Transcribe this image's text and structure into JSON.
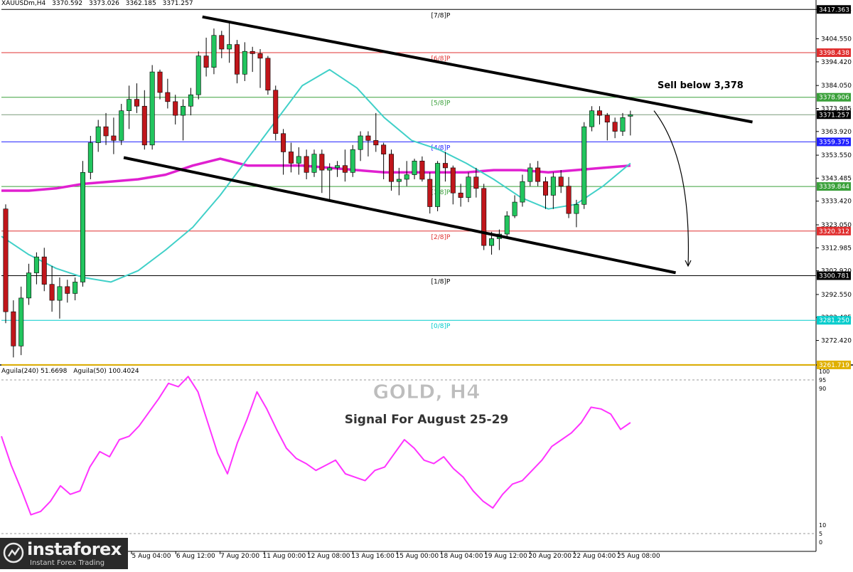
{
  "header": {
    "symbol": "XAUUSDm,H4",
    "ohlc": [
      "3370.592",
      "3373.026",
      "3362.185",
      "3371.257"
    ]
  },
  "indicator_header": {
    "name1": "Aguila(240) 51.6698",
    "name2": "Aguila(50) 100.4024"
  },
  "overlay": {
    "title": "GOLD, H4",
    "subtitle": "Signal For August 25-29",
    "annotation": "Sell below 3,378"
  },
  "logo": {
    "name": "instaforex",
    "tagline": "Instant Forex Trading"
  },
  "colors": {
    "bull": "#22c55e",
    "bear": "#c0161b",
    "ma_fast": "#40d0c8",
    "ma_slow": "#e020d0",
    "rsi": "#ff33ff",
    "murrey_red": "#e03030",
    "murrey_green": "#3aa03a",
    "murrey_blue": "#2020ff",
    "murrey_black": "#000000",
    "murrey_cyan": "#00cccc",
    "murrey_yellow": "#e0b000",
    "channel": "#000000"
  },
  "chart_data": {
    "type": "candlestick",
    "ylim": [
      3262,
      3419
    ],
    "y_ticks": [
      "3417.363",
      "3404.550",
      "3394.420",
      "3384.050",
      "3373.985",
      "3363.920",
      "3353.550",
      "3343.485",
      "3333.420",
      "3323.050",
      "3312.985",
      "3302.920",
      "3292.550",
      "3282.485",
      "3272.420"
    ],
    "x_labels": [
      "5 Aug 04:00",
      "6 Aug 12:00",
      "7 Aug 20:00",
      "11 Aug 00:00",
      "12 Aug 08:00",
      "13 Aug 16:00",
      "15 Aug 00:00",
      "18 Aug 04:00",
      "19 Aug 12:00",
      "20 Aug 20:00",
      "22 Aug 04:00",
      "25 Aug 08:00"
    ],
    "murrey_levels": [
      {
        "label": "[7/8]P",
        "price": "3417.363",
        "color": "murrey_black"
      },
      {
        "label": "[6/8]P",
        "price": "3398.438",
        "color": "murrey_red"
      },
      {
        "label": "[5/8]P",
        "price": "3378.906",
        "color": "murrey_green"
      },
      {
        "label": "[4/8]P",
        "price": "3359.375",
        "color": "murrey_blue"
      },
      {
        "label": "[3/8]P",
        "price": "3339.844",
        "color": "murrey_green"
      },
      {
        "label": "[2/8]P",
        "price": "3320.312",
        "color": "murrey_red"
      },
      {
        "label": "[1/8]P",
        "price": "3300.781",
        "color": "murrey_black"
      },
      {
        "label": "[0/8]P",
        "price": "3281.250",
        "color": "murrey_cyan"
      },
      {
        "label": "",
        "price": "3261.719",
        "color": "murrey_yellow"
      }
    ],
    "current_price": "3371.257",
    "candles": [
      [
        3330,
        3332,
        3280,
        3285
      ],
      [
        3285,
        3290,
        3265,
        3270
      ],
      [
        3270,
        3296,
        3266,
        3291
      ],
      [
        3291,
        3306,
        3288,
        3302
      ],
      [
        3302,
        3311,
        3297,
        3309
      ],
      [
        3309,
        3313,
        3294,
        3297
      ],
      [
        3297,
        3305,
        3285,
        3290
      ],
      [
        3290,
        3300,
        3282,
        3296
      ],
      [
        3296,
        3299,
        3289,
        3293
      ],
      [
        3293,
        3300,
        3290,
        3298
      ],
      [
        3298,
        3351,
        3296,
        3346
      ],
      [
        3346,
        3362,
        3343,
        3359
      ],
      [
        3359,
        3369,
        3355,
        3366
      ],
      [
        3366,
        3372,
        3358,
        3362
      ],
      [
        3362,
        3370,
        3354,
        3360
      ],
      [
        3360,
        3376,
        3358,
        3373
      ],
      [
        3373,
        3384,
        3365,
        3378
      ],
      [
        3378,
        3385,
        3372,
        3375
      ],
      [
        3375,
        3382,
        3356,
        3358
      ],
      [
        3358,
        3393,
        3356,
        3390
      ],
      [
        3390,
        3391,
        3378,
        3381
      ],
      [
        3381,
        3387,
        3374,
        3377
      ],
      [
        3377,
        3380,
        3367,
        3371
      ],
      [
        3371,
        3378,
        3360,
        3375
      ],
      [
        3375,
        3383,
        3371,
        3380
      ],
      [
        3380,
        3399,
        3378,
        3397
      ],
      [
        3397,
        3405,
        3388,
        3392
      ],
      [
        3392,
        3409,
        3389,
        3406
      ],
      [
        3406,
        3408,
        3396,
        3400
      ],
      [
        3400,
        3412,
        3394,
        3402
      ],
      [
        3402,
        3404,
        3385,
        3389
      ],
      [
        3389,
        3403,
        3386,
        3399
      ],
      [
        3399,
        3401,
        3390,
        3398
      ],
      [
        3398,
        3400,
        3383,
        3396
      ],
      [
        3396,
        3397,
        3380,
        3382
      ],
      [
        3382,
        3384,
        3360,
        3363
      ],
      [
        3363,
        3365,
        3345,
        3355
      ],
      [
        3355,
        3359,
        3346,
        3350
      ],
      [
        3350,
        3357,
        3345,
        3353
      ],
      [
        3353,
        3356,
        3343,
        3346
      ],
      [
        3346,
        3356,
        3344,
        3354
      ],
      [
        3354,
        3356,
        3337,
        3347
      ],
      [
        3347,
        3350,
        3334,
        3348
      ],
      [
        3348,
        3351,
        3344,
        3349
      ],
      [
        3349,
        3356,
        3342,
        3346
      ],
      [
        3346,
        3358,
        3344,
        3356
      ],
      [
        3356,
        3364,
        3351,
        3362
      ],
      [
        3362,
        3364,
        3353,
        3360
      ],
      [
        3360,
        3372,
        3355,
        3358
      ],
      [
        3358,
        3359,
        3343,
        3354
      ],
      [
        3354,
        3356,
        3338,
        3342
      ],
      [
        3342,
        3348,
        3336,
        3343
      ],
      [
        3343,
        3351,
        3340,
        3345
      ],
      [
        3345,
        3352,
        3343,
        3351
      ],
      [
        3351,
        3353,
        3342,
        3343
      ],
      [
        3343,
        3346,
        3328,
        3331
      ],
      [
        3331,
        3351,
        3329,
        3350
      ],
      [
        3350,
        3355,
        3342,
        3348
      ],
      [
        3348,
        3349,
        3332,
        3337
      ],
      [
        3337,
        3341,
        3331,
        3335
      ],
      [
        3335,
        3346,
        3333,
        3344
      ],
      [
        3344,
        3348,
        3335,
        3339
      ],
      [
        3339,
        3341,
        3312,
        3314
      ],
      [
        3314,
        3320,
        3310,
        3317
      ],
      [
        3317,
        3321,
        3312,
        3319
      ],
      [
        3319,
        3329,
        3317,
        3327
      ],
      [
        3327,
        3336,
        3326,
        3333
      ],
      [
        3333,
        3345,
        3331,
        3342
      ],
      [
        3342,
        3350,
        3340,
        3348
      ],
      [
        3348,
        3351,
        3340,
        3342
      ],
      [
        3342,
        3344,
        3330,
        3336
      ],
      [
        3336,
        3346,
        3330,
        3344
      ],
      [
        3344,
        3347,
        3337,
        3340
      ],
      [
        3340,
        3344,
        3326,
        3328
      ],
      [
        3328,
        3334,
        3322,
        3332
      ],
      [
        3332,
        3368,
        3330,
        3366
      ],
      [
        3366,
        3375,
        3364,
        3373
      ],
      [
        3373,
        3375,
        3367,
        3371
      ],
      [
        3371,
        3372,
        3360,
        3368
      ],
      [
        3368,
        3370,
        3361,
        3364
      ],
      [
        3364,
        3372,
        3362,
        3370
      ],
      [
        3370.592,
        3373.026,
        3362.185,
        3371.257
      ]
    ],
    "ma_fast_values": [
      3318,
      3310,
      3304,
      3300,
      3298,
      3303,
      3312,
      3322,
      3336,
      3352,
      3368,
      3384,
      3391,
      3383,
      3370,
      3360,
      3356,
      3350,
      3343,
      3335,
      3330,
      3332,
      3340,
      3350
    ],
    "ma_slow_values": [
      3338,
      3338,
      3339,
      3341,
      3342,
      3343,
      3345,
      3349,
      3352,
      3349,
      3349,
      3349,
      3348,
      3347,
      3346,
      3346,
      3346,
      3346,
      3347,
      3347,
      3346,
      3347,
      3348,
      3349
    ],
    "channel": {
      "upper": {
        "from": [
          2,
          3411
        ],
        "to": [
          83,
          3369
        ]
      },
      "lower": {
        "from": [
          13,
          3350
        ],
        "to": [
          83,
          3303
        ]
      }
    },
    "forecast_arrow": {
      "from": [
        82,
        3373
      ],
      "to": [
        85,
        3305
      ]
    },
    "rsi": {
      "ylim": [
        0,
        100
      ],
      "ticks": [
        "100",
        "95",
        "90",
        "10",
        "5",
        "0"
      ],
      "values": [
        62,
        45,
        31,
        16,
        18,
        24,
        33,
        28,
        30,
        44,
        53,
        50,
        60,
        62,
        68,
        76,
        84,
        93,
        91,
        97,
        88,
        70,
        52,
        40,
        58,
        72,
        88,
        78,
        66,
        55,
        49,
        46,
        42,
        45,
        48,
        40,
        38,
        36,
        42,
        44,
        52,
        60,
        55,
        48,
        46,
        50,
        43,
        38,
        30,
        24,
        20,
        28,
        34,
        36,
        42,
        48,
        56,
        60,
        64,
        70,
        79,
        78,
        75,
        66,
        70
      ]
    }
  }
}
